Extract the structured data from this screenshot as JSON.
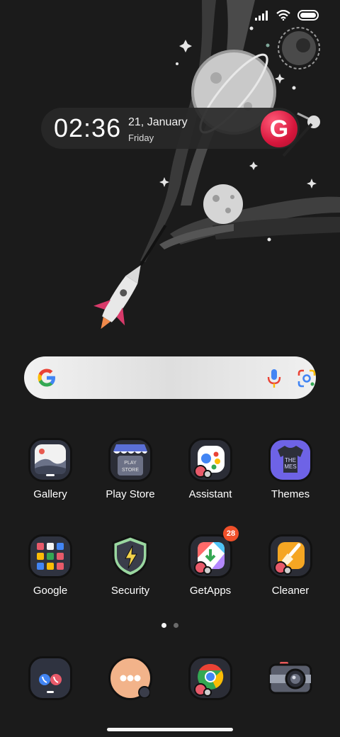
{
  "status_bar": {
    "icons": [
      "cellular-signal-icon",
      "wifi-icon",
      "battery-icon"
    ]
  },
  "clock_widget": {
    "time": "02:36",
    "date": "21, January",
    "day": "Friday",
    "avatar_letter": "G"
  },
  "search_bar": {
    "logo": "google-g-icon",
    "mic": "microphone-icon",
    "lens": "google-lens-icon"
  },
  "apps": [
    {
      "label": "Gallery"
    },
    {
      "label": "Play Store"
    },
    {
      "label": "Assistant"
    },
    {
      "label": "Themes"
    },
    {
      "label": "Google"
    },
    {
      "label": "Security"
    },
    {
      "label": "GetApps",
      "badge": "28"
    },
    {
      "label": "Cleaner"
    }
  ],
  "dock": [
    {
      "icon": "phone-icon"
    },
    {
      "icon": "messages-icon"
    },
    {
      "icon": "chrome-icon"
    },
    {
      "icon": "camera-icon"
    }
  ],
  "page_indicator": {
    "current": 1,
    "total": 2
  },
  "colors": {
    "badge": "#f0502a",
    "avatar": "#d6163c",
    "background": "#1b1b1b"
  }
}
